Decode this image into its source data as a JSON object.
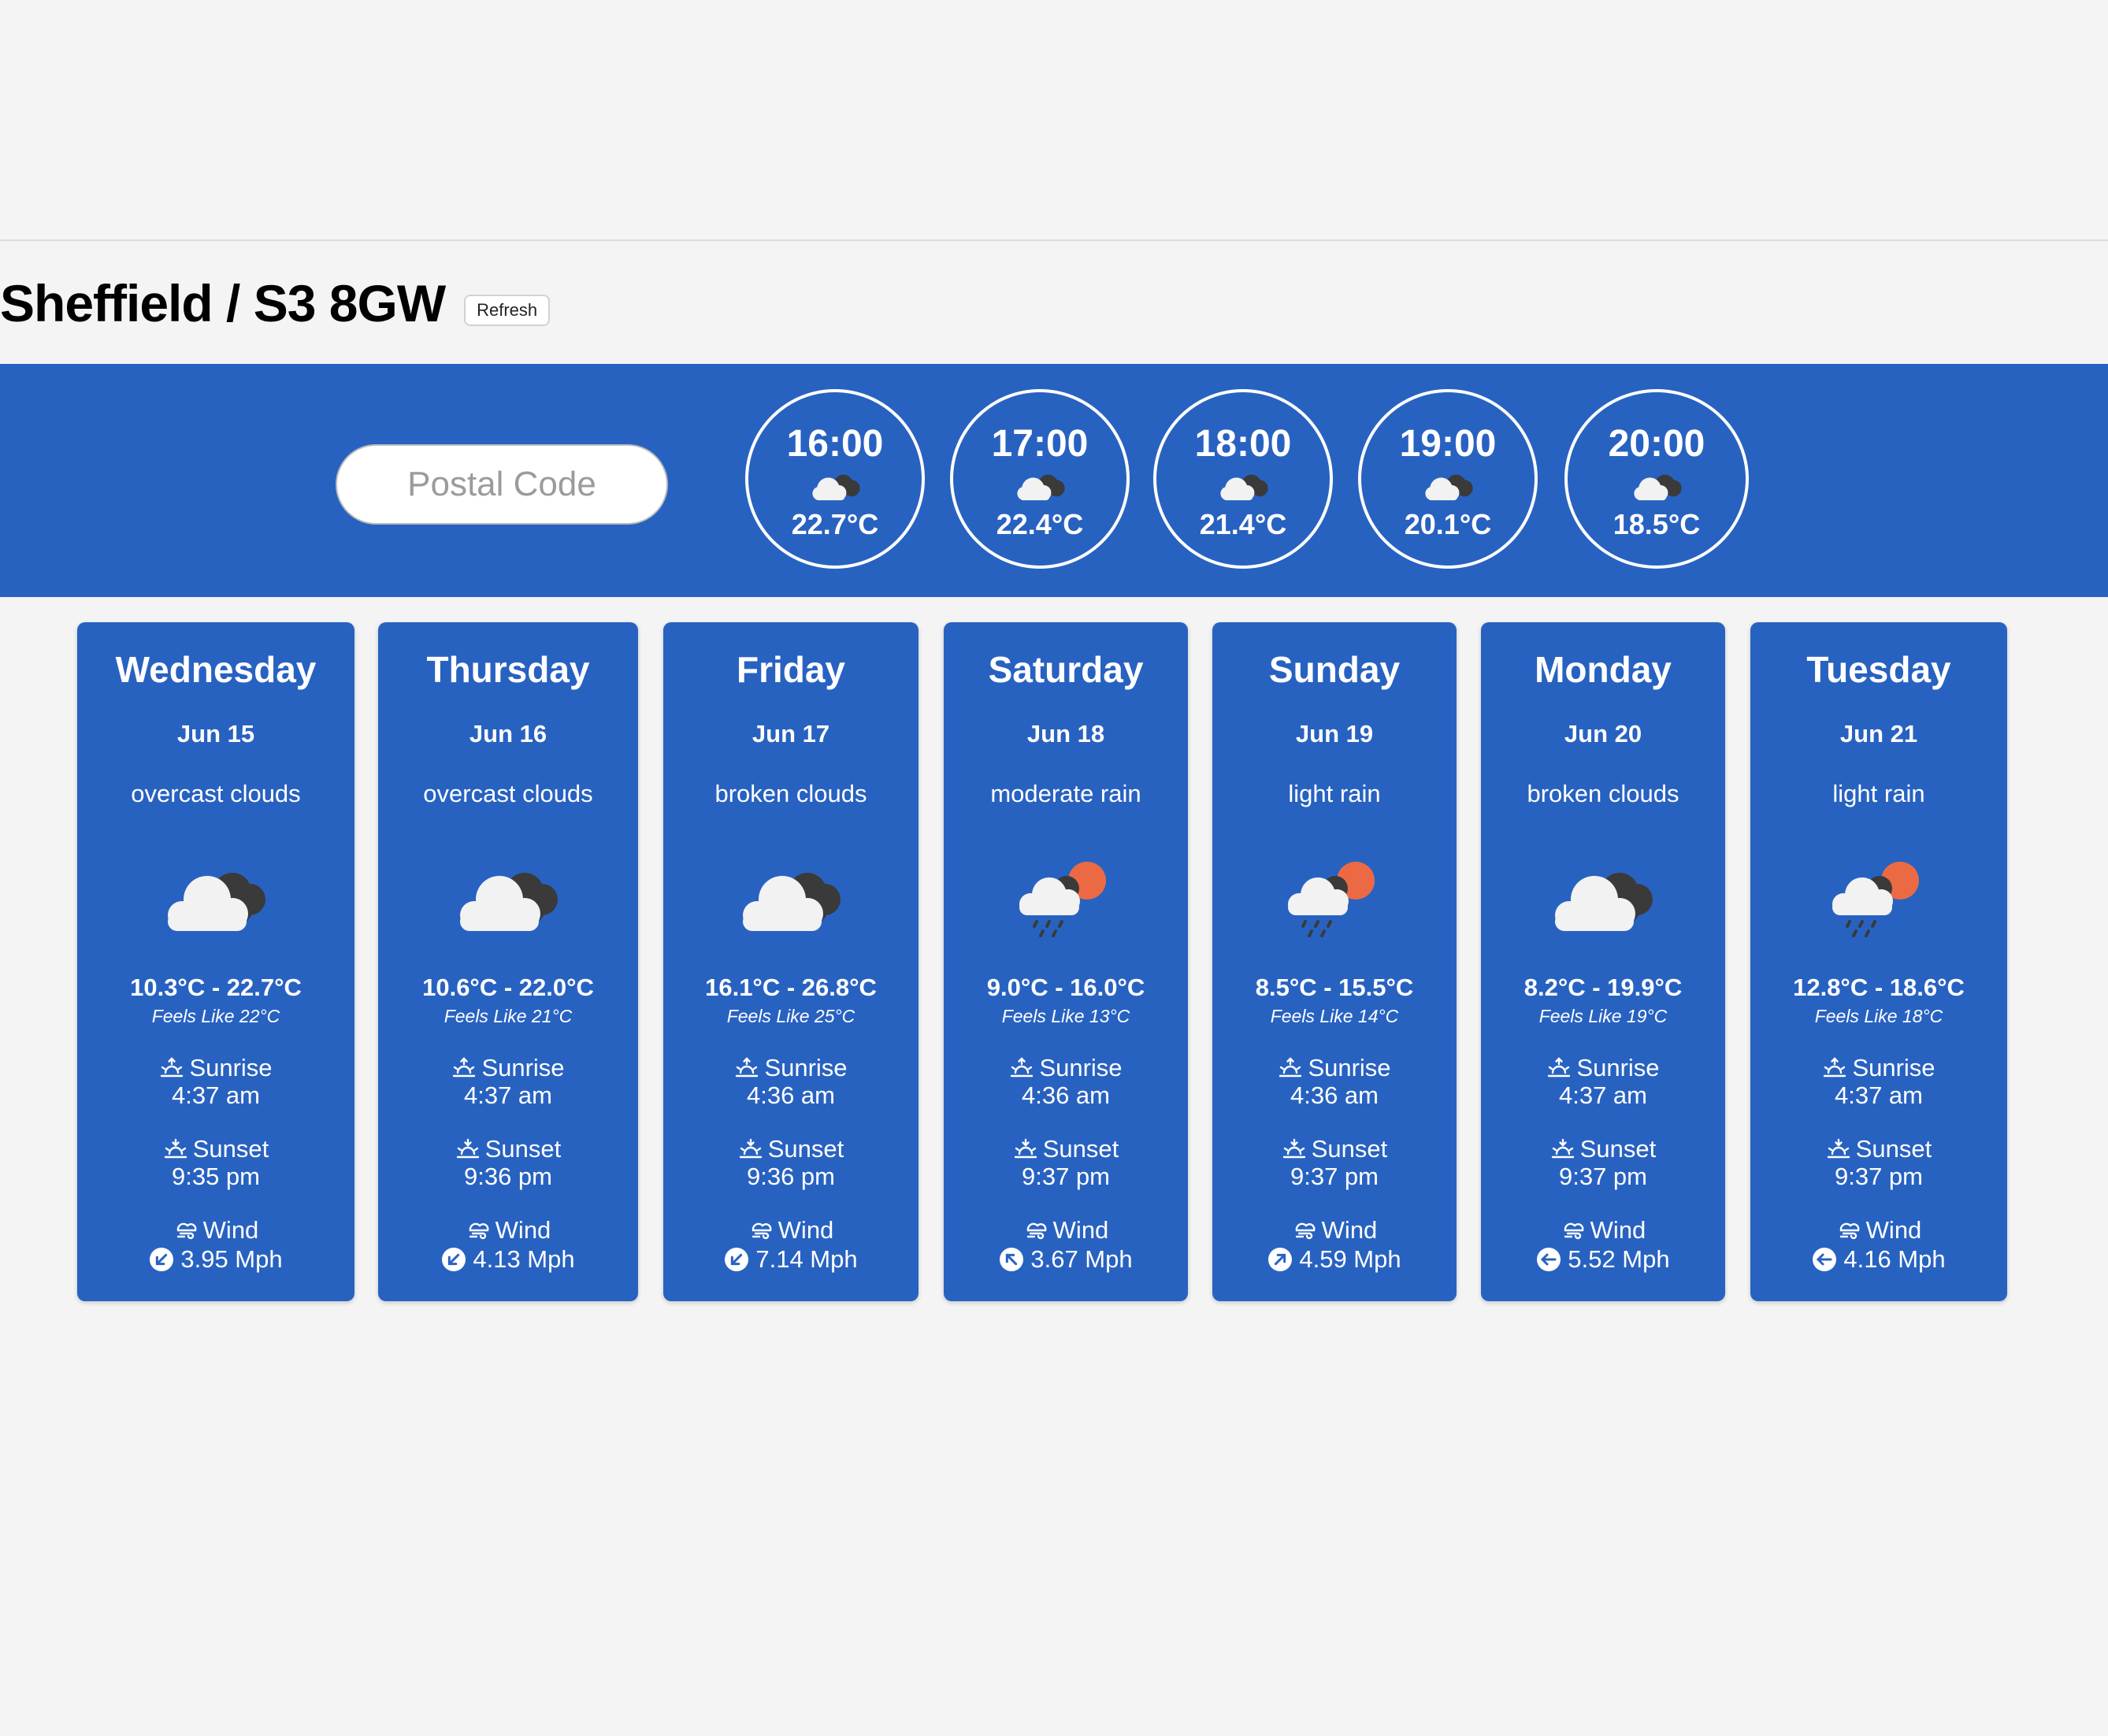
{
  "header": {
    "location": "Sheffield / S3 8GW",
    "refresh_label": "Refresh"
  },
  "search": {
    "placeholder": "Postal Code"
  },
  "hourly": [
    {
      "time": "16:00",
      "temp": "22.7°C",
      "icon": "cloud-icon"
    },
    {
      "time": "17:00",
      "temp": "22.4°C",
      "icon": "cloud-icon"
    },
    {
      "time": "18:00",
      "temp": "21.4°C",
      "icon": "cloud-icon"
    },
    {
      "time": "19:00",
      "temp": "20.1°C",
      "icon": "cloud-icon"
    },
    {
      "time": "20:00",
      "temp": "18.5°C",
      "icon": "cloud-icon"
    }
  ],
  "labels": {
    "sunrise": "Sunrise",
    "sunset": "Sunset",
    "wind": "Wind"
  },
  "days": [
    {
      "day": "Wednesday",
      "date": "Jun 15",
      "desc": "overcast clouds",
      "icon": "cloud-icon",
      "range": "10.3°C - 22.7°C",
      "feels": "Feels Like 22°C",
      "sunrise": "4:37 am",
      "sunset": "9:35 pm",
      "wind": "3.95 Mph",
      "wind_dir": "down-left-arrow-icon"
    },
    {
      "day": "Thursday",
      "date": "Jun 16",
      "desc": "overcast clouds",
      "icon": "cloud-icon",
      "range": "10.6°C - 22.0°C",
      "feels": "Feels Like 21°C",
      "sunrise": "4:37 am",
      "sunset": "9:36 pm",
      "wind": "4.13 Mph",
      "wind_dir": "down-left-arrow-icon"
    },
    {
      "day": "Friday",
      "date": "Jun 17",
      "desc": "broken clouds",
      "icon": "cloud-icon",
      "range": "16.1°C - 26.8°C",
      "feels": "Feels Like 25°C",
      "sunrise": "4:36 am",
      "sunset": "9:36 pm",
      "wind": "7.14 Mph",
      "wind_dir": "down-left-arrow-icon"
    },
    {
      "day": "Saturday",
      "date": "Jun 18",
      "desc": "moderate rain",
      "icon": "rain-sun-icon",
      "range": "9.0°C - 16.0°C",
      "feels": "Feels Like 13°C",
      "sunrise": "4:36 am",
      "sunset": "9:37 pm",
      "wind": "3.67 Mph",
      "wind_dir": "up-left-arrow-icon"
    },
    {
      "day": "Sunday",
      "date": "Jun 19",
      "desc": "light rain",
      "icon": "rain-sun-icon",
      "range": "8.5°C - 15.5°C",
      "feels": "Feels Like 14°C",
      "sunrise": "4:36 am",
      "sunset": "9:37 pm",
      "wind": "4.59 Mph",
      "wind_dir": "up-right-arrow-icon"
    },
    {
      "day": "Monday",
      "date": "Jun 20",
      "desc": "broken clouds",
      "icon": "cloud-icon",
      "range": "8.2°C - 19.9°C",
      "feels": "Feels Like 19°C",
      "sunrise": "4:37 am",
      "sunset": "9:37 pm",
      "wind": "5.52 Mph",
      "wind_dir": "left-arrow-icon"
    },
    {
      "day": "Tuesday",
      "date": "Jun 21",
      "desc": "light rain",
      "icon": "rain-sun-icon",
      "range": "12.8°C - 18.6°C",
      "feels": "Feels Like 18°C",
      "sunrise": "4:37 am",
      "sunset": "9:37 pm",
      "wind": "4.16 Mph",
      "wind_dir": "left-arrow-icon"
    }
  ],
  "colors": {
    "banner": "#2862c1",
    "page_bg": "#f4f4f4",
    "cloud_front": "#f2f2f2",
    "cloud_back": "#3a3a3a",
    "sun": "#ec6a43"
  }
}
